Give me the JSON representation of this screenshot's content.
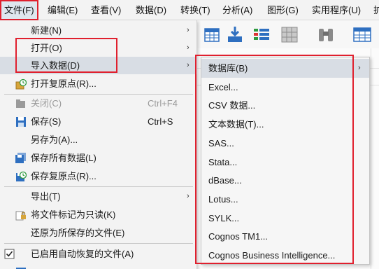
{
  "menubar": {
    "items": [
      {
        "label": "文件(F)"
      },
      {
        "label": "编辑(E)"
      },
      {
        "label": "查看(V)"
      },
      {
        "label": "数据(D)"
      },
      {
        "label": "转换(T)"
      },
      {
        "label": "分析(A)"
      },
      {
        "label": "图形(G)"
      },
      {
        "label": "实用程序(U)"
      },
      {
        "label": "扩"
      }
    ]
  },
  "file_menu": {
    "items": [
      {
        "label": "新建(N)"
      },
      {
        "label": "打开(O)"
      },
      {
        "label": "导入数据(D)"
      },
      {
        "label": "打开复原点(R)..."
      },
      {
        "label": "关闭(C)",
        "shortcut": "Ctrl+F4"
      },
      {
        "label": "保存(S)",
        "shortcut": "Ctrl+S"
      },
      {
        "label": "另存为(A)..."
      },
      {
        "label": "保存所有数据(L)"
      },
      {
        "label": "保存复原点(R)..."
      },
      {
        "label": "导出(T)"
      },
      {
        "label": "将文件标记为只读(K)"
      },
      {
        "label": "还原为所保存的文件(E)"
      },
      {
        "label": "已启用自动恢复的文件(A)"
      }
    ]
  },
  "import_submenu": {
    "items": [
      {
        "label": "数据库(B)"
      },
      {
        "label": "Excel..."
      },
      {
        "label": "CSV 数据..."
      },
      {
        "label": "文本数据(T)..."
      },
      {
        "label": "SAS..."
      },
      {
        "label": "Stata..."
      },
      {
        "label": "dBase..."
      },
      {
        "label": "Lotus..."
      },
      {
        "label": "SYLK..."
      },
      {
        "label": "Cognos TM1..."
      },
      {
        "label": "Cognos Business Intelligence..."
      }
    ]
  },
  "icons": [
    "arrow-right-icon",
    "open-restore-icon",
    "close-file-icon",
    "save-icon",
    "save-all-icon",
    "save-restore-icon",
    "read-only-lock-icon",
    "checkbox-checked-icon",
    "data-editor-icon",
    "import-download-icon",
    "variable-list-icon",
    "grid-table-icon",
    "binoculars-icon",
    "table-icon"
  ],
  "colors": {
    "highlight_box": "#e0202e",
    "hover": "#d8dde4",
    "toolbar_blue": "#2e6fc0"
  }
}
